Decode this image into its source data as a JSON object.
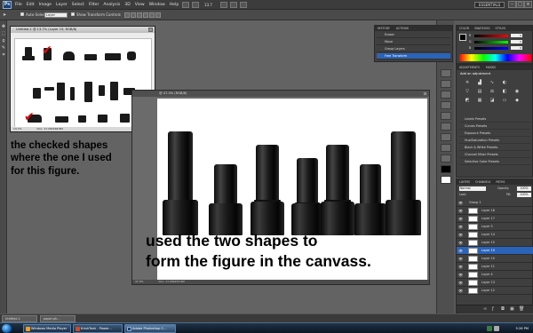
{
  "app": {
    "menu": [
      "File",
      "Edit",
      "Image",
      "Layer",
      "Select",
      "Filter",
      "Analysis",
      "3D",
      "View",
      "Window",
      "Help"
    ],
    "workspace_label": "ESSENTIALS",
    "zoom_readout": "13.7",
    "logo_text": "Ps"
  },
  "options_bar": {
    "auto_select_label": "Auto-Select:",
    "auto_select_value": "Layer",
    "show_transform_label": "Show Transform Controls"
  },
  "small_window": {
    "title": "Untitled-1 @ 13.7% (Layer 19, RGB/8)",
    "zoom": "13.7%",
    "doc_info": "Doc: 17.2M/168.8M"
  },
  "main_window": {
    "title": "@ 47.0% (RGB/8)",
    "zoom": "47.0%",
    "doc_info": "Doc: 17.2M/253.9M"
  },
  "annotations": {
    "left_text": [
      "the checked shapes",
      "where the one I used",
      "for this figure."
    ],
    "canvas_text": [
      "used the two shapes to",
      "form the figure in the canvass."
    ]
  },
  "history_panel": {
    "tabs": [
      "HISTORY",
      "ACTIONS"
    ],
    "items": [
      "Eraser",
      "Move",
      "Group Layers",
      "Free Transform"
    ],
    "selected_index": 3
  },
  "color_panel": {
    "tabs": [
      "COLOR",
      "SWATCHES",
      "STYLES"
    ],
    "channels": [
      {
        "label": "R",
        "value": "0"
      },
      {
        "label": "G",
        "value": "0"
      },
      {
        "label": "B",
        "value": "0"
      }
    ]
  },
  "adjustments_panel": {
    "tabs": [
      "ADJUSTMENTS",
      "MASKS"
    ],
    "heading": "Add an adjustment",
    "presets": [
      "Levels Presets",
      "Curves Presets",
      "Exposure Presets",
      "Hue/Saturation Presets",
      "Black & White Presets",
      "Channel Mixer Presets",
      "Selective Color Presets"
    ]
  },
  "layers_panel": {
    "tabs": [
      "LAYERS",
      "CHANNELS",
      "PATHS"
    ],
    "blend_mode": "Normal",
    "opacity_label": "Opacity:",
    "opacity_value": "100%",
    "fill_label": "Fill:",
    "fill_value": "100%",
    "lock_label": "Lock:",
    "group_name": "Group 1",
    "layers": [
      "Layer 16",
      "Layer 17",
      "Layer 5",
      "Layer 14",
      "Layer 15",
      "Layer 19",
      "Layer 10",
      "Layer 11",
      "Layer 4",
      "Layer 13",
      "Layer 12"
    ],
    "selected_layer": "Layer 19"
  },
  "doc_tabs": [
    "Untitled-1",
    "paper-ph..."
  ],
  "taskbar": {
    "items": [
      "Windows Media Player",
      "thinkTank - Power...",
      "Adobe Photoshop C..."
    ],
    "clock": "5:26 PM"
  },
  "colors": {
    "selection_blue": "#2b63b8",
    "check_red": "#d81111",
    "shape_black": "#111111"
  }
}
